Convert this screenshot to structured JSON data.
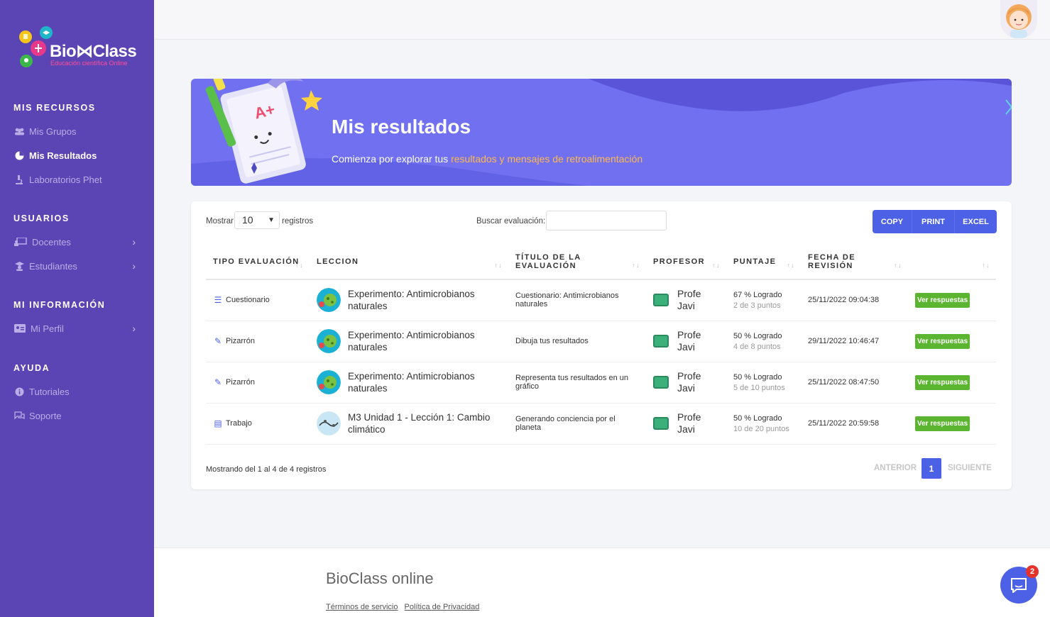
{
  "brand": {
    "name": "Bio⋈Class",
    "tagline": "Educación científica Online",
    "accent": "#5b44b3",
    "primary": "#4d61e6",
    "success": "#5cb531"
  },
  "sidebar": {
    "sections": [
      {
        "title": "MIS RECURSOS",
        "items": [
          {
            "label": "Mis Grupos",
            "icon": "users-icon"
          },
          {
            "label": "Mis Resultados",
            "icon": "pie-chart-icon",
            "active": true
          },
          {
            "label": "Laboratorios Phet",
            "icon": "microscope-icon"
          }
        ]
      },
      {
        "title": "USUARIOS",
        "items": [
          {
            "label": "Docentes",
            "icon": "chalkboard-icon"
          },
          {
            "label": "Estudiantes",
            "icon": "graduate-icon"
          }
        ]
      },
      {
        "title": "MI INFORMACIÓN",
        "items": [
          {
            "label": "Mi Perfil",
            "icon": "id-card-icon"
          }
        ]
      },
      {
        "title": "AYUDA",
        "items": [
          {
            "label": "Tutoriales",
            "icon": "info-icon"
          },
          {
            "label": "Soporte",
            "icon": "chat-icon"
          }
        ]
      }
    ]
  },
  "banner": {
    "title": "Mis resultados",
    "subtitle_prefix": "Comienza por explorar tus ",
    "subtitle_highlight": "resultados y mensajes de retroalimentación"
  },
  "table_controls": {
    "show_label": "Mostrar",
    "show_value": "10",
    "records_label": "registros",
    "search_label": "Buscar evaluación:",
    "search_value": "",
    "buttons": [
      "COPY",
      "PRINT",
      "EXCEL"
    ]
  },
  "table": {
    "headers": [
      "TIPO EVALUACIÓN",
      "LECCION",
      "TÍTULO DE LA EVALUACIÓN",
      "PROFESOR",
      "PUNTAJE",
      "FECHA DE REVISIÓN",
      ""
    ],
    "rows": [
      {
        "tipo": "Cuestionario",
        "tipo_icon": "list-check-icon",
        "leccion": "Experimento: Antimicrobianos naturales",
        "titulo": "Cuestionario: Antimicrobianos naturales",
        "profesor": "Profe Javi",
        "puntaje": "67 % Logrado",
        "puntos": "2 de 3 puntos",
        "fecha": "25/11/2022 09:04:38",
        "accion": "Ver respuestas"
      },
      {
        "tipo": "Pizarrón",
        "tipo_icon": "brush-icon",
        "leccion": "Experimento: Antimicrobianos naturales",
        "titulo": "Dibuja tus resultados",
        "profesor": "Profe Javi",
        "puntaje": "50 % Logrado",
        "puntos": "4 de 8 puntos",
        "fecha": "29/11/2022 10:46:47",
        "accion": "Ver respuestas"
      },
      {
        "tipo": "Pizarrón",
        "tipo_icon": "brush-icon",
        "leccion": "Experimento: Antimicrobianos naturales",
        "titulo": "Representa tus resultados en un gráfico",
        "profesor": "Profe Javi",
        "puntaje": "50 % Logrado",
        "puntos": "5 de 10 puntos",
        "fecha": "25/11/2022 08:47:50",
        "accion": "Ver respuestas"
      },
      {
        "tipo": "Trabajo",
        "tipo_icon": "document-icon",
        "leccion": "M3 Unidad 1 - Lección 1: Cambio climático",
        "titulo": "Generando conciencia por el planeta",
        "profesor": "Profe Javi",
        "puntaje": "50 % Logrado",
        "puntos": "10 de 20 puntos",
        "fecha": "25/11/2022 20:59:58",
        "accion": "Ver respuestas"
      }
    ]
  },
  "pagination": {
    "info": "Mostrando del 1 al 4 de 4 registros",
    "prev": "ANTERIOR",
    "current": "1",
    "next": "SIGUIENTE"
  },
  "footer": {
    "title": "BioClass online",
    "links": [
      "Términos de servicio",
      "Política de Privacidad"
    ]
  },
  "chat": {
    "badge": "2"
  }
}
